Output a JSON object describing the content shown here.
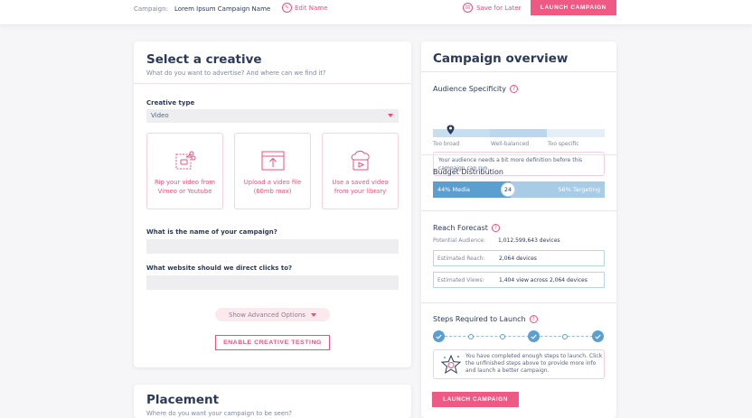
{
  "topbar": {
    "campaign_label": "Campaign:",
    "campaign_name": "Lorem Ipsum Campaign Name",
    "edit_name": "Edit Name",
    "save_for_later": "Save for Later",
    "launch": "LAUNCH CAMPAIGN"
  },
  "creative": {
    "title": "Select a creative",
    "subtitle": "What do you want to advertise? And where can we find it?",
    "type_label": "Creative type",
    "type_value": "Video",
    "tiles": [
      {
        "label": "Rip your video from Vimeo or Youtube",
        "icon": "rip-video-icon"
      },
      {
        "label": "Upload a video file (60mb max)",
        "icon": "upload-video-icon"
      },
      {
        "label": "Use a saved video from your library",
        "icon": "cloud-library-icon"
      }
    ],
    "name_question": "What is the name of your campaign?",
    "website_question": "What website should we direct clicks to?",
    "advanced": "Show Advanced Options",
    "enable_testing": "ENABLE CREATIVE TESTING"
  },
  "placement": {
    "title": "Placement",
    "subtitle": "Where do you want your campaign to be seen?"
  },
  "overview": {
    "title": "Campaign overview",
    "specificity": {
      "title": "Audience Specificity",
      "labels": [
        "Too broad",
        "Well-balanced",
        "Too specific"
      ],
      "note": "Your audience needs a bit more definition before this campaign can run."
    },
    "budget": {
      "title": "Budget Distribution",
      "media": "44% Media",
      "targeting": "56% Targeting",
      "knob": "24"
    },
    "reach": {
      "title": "Reach Forecast",
      "potential_label": "Potential Audience:",
      "potential_value": "1,012,599,643 devices",
      "est_reach_label": "Estimated Reach:",
      "est_reach_value": "2,064 devices",
      "est_views_label": "Estimated Views:",
      "est_views_value": "1,404 view across 2,064 devices"
    },
    "steps": {
      "title": "Steps Required to Launch",
      "note": "You have completed enough steps to launch. Click the unfinished steps above to provide more info and launch a better campaign.",
      "launch": "LAUNCH CAMPAIGN"
    }
  },
  "colors": {
    "accent": "#ef4f7c",
    "navy": "#2b3a5a",
    "blue": "#5b9fd1"
  }
}
